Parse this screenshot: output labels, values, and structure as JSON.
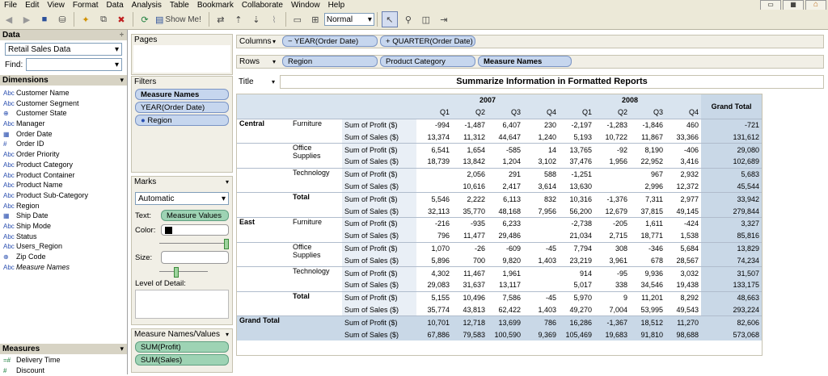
{
  "menu": [
    "File",
    "Edit",
    "View",
    "Format",
    "Data",
    "Analysis",
    "Table",
    "Bookmark",
    "Collaborate",
    "Window",
    "Help"
  ],
  "toolbar": {
    "show_me": "Show Me!",
    "fit": "Normal"
  },
  "data_pane": {
    "header": "Data",
    "source": "Retail Sales Data",
    "find_label": "Find:",
    "dimensions_header": "Dimensions",
    "dimensions": [
      {
        "icon": "Abc",
        "name": "Customer Name"
      },
      {
        "icon": "Abc",
        "name": "Customer Segment"
      },
      {
        "icon": "⊕",
        "name": "Customer State"
      },
      {
        "icon": "Abc",
        "name": "Manager"
      },
      {
        "icon": "▦",
        "name": "Order Date"
      },
      {
        "icon": "#",
        "name": "Order ID"
      },
      {
        "icon": "Abc",
        "name": "Order Priority"
      },
      {
        "icon": "Abc",
        "name": "Product Category"
      },
      {
        "icon": "Abc",
        "name": "Product Container"
      },
      {
        "icon": "Abc",
        "name": "Product Name"
      },
      {
        "icon": "Abc",
        "name": "Product Sub-Category"
      },
      {
        "icon": "Abc",
        "name": "Region"
      },
      {
        "icon": "▦",
        "name": "Ship Date"
      },
      {
        "icon": "Abc",
        "name": "Ship Mode"
      },
      {
        "icon": "Abc",
        "name": "Status"
      },
      {
        "icon": "Abc",
        "name": "Users_Region"
      },
      {
        "icon": "⊕",
        "name": "Zip Code"
      },
      {
        "icon": "Abc",
        "name": "Measure Names"
      }
    ],
    "measures_header": "Measures",
    "measures": [
      {
        "icon": "=#",
        "name": "Delivery Time"
      },
      {
        "icon": "#",
        "name": "Discount"
      }
    ]
  },
  "pages": {
    "label": "Pages"
  },
  "filters": {
    "label": "Filters",
    "items": [
      "Measure Names",
      "YEAR(Order Date)",
      "Region"
    ]
  },
  "marks": {
    "label": "Marks",
    "type": "Automatic",
    "text_label": "Text:",
    "text_pill": "Measure Values",
    "color_label": "Color:",
    "size_label": "Size:",
    "lod_label": "Level of Detail:"
  },
  "measure_values": {
    "label": "Measure Names/Values",
    "items": [
      "SUM(Profit)",
      "SUM(Sales)"
    ]
  },
  "columns": {
    "label": "Columns",
    "pills": [
      "YEAR(Order Date)",
      "QUARTER(Order Date)"
    ],
    "signs": [
      "−",
      "+"
    ]
  },
  "rows": {
    "label": "Rows",
    "pills": [
      "Region",
      "Product Category",
      "Measure Names"
    ]
  },
  "title": {
    "label": "Title",
    "text": "Summarize Information in Formatted Reports"
  },
  "crosstab": {
    "years": [
      "2007",
      "2008"
    ],
    "quarters": [
      "Q1",
      "Q2",
      "Q3",
      "Q4"
    ],
    "grand_total": "Grand Total",
    "measures": [
      "Sum of Profit ($)",
      "Sum of Sales ($)"
    ],
    "rows": [
      {
        "region": "Central",
        "category": "Furniture",
        "profit": [
          "-994",
          "-1,487",
          "6,407",
          "230",
          "-2,197",
          "-1,283",
          "-1,846",
          "460",
          "-721"
        ],
        "sales": [
          "13,374",
          "11,312",
          "44,647",
          "1,240",
          "5,193",
          "10,722",
          "11,867",
          "33,366",
          "131,612"
        ]
      },
      {
        "region": "",
        "category": "Office Supplies",
        "profit": [
          "6,541",
          "1,654",
          "-585",
          "14",
          "13,765",
          "-92",
          "8,190",
          "-406",
          "29,080"
        ],
        "sales": [
          "18,739",
          "13,842",
          "1,204",
          "3,102",
          "37,476",
          "1,956",
          "22,952",
          "3,416",
          "102,689"
        ]
      },
      {
        "region": "",
        "category": "Technology",
        "profit": [
          "",
          "2,056",
          "291",
          "588",
          "-1,251",
          "",
          "967",
          "2,932",
          "5,683"
        ],
        "sales": [
          "",
          "10,616",
          "2,417",
          "3,614",
          "13,630",
          "",
          "2,996",
          "12,372",
          "45,544"
        ]
      },
      {
        "region": "",
        "category": "Total",
        "profit": [
          "5,546",
          "2,222",
          "6,113",
          "832",
          "10,316",
          "-1,376",
          "7,311",
          "2,977",
          "33,942"
        ],
        "sales": [
          "32,113",
          "35,770",
          "48,168",
          "7,956",
          "56,200",
          "12,679",
          "37,815",
          "49,145",
          "279,844"
        ]
      },
      {
        "region": "East",
        "category": "Furniture",
        "profit": [
          "-216",
          "-935",
          "6,233",
          "",
          "-2,738",
          "-205",
          "1,611",
          "-424",
          "3,327"
        ],
        "sales": [
          "796",
          "11,477",
          "29,486",
          "",
          "21,034",
          "2,715",
          "18,771",
          "1,538",
          "85,816"
        ]
      },
      {
        "region": "",
        "category": "Office Supplies",
        "profit": [
          "1,070",
          "-26",
          "-609",
          "-45",
          "7,794",
          "308",
          "-346",
          "5,684",
          "13,829"
        ],
        "sales": [
          "5,896",
          "700",
          "9,820",
          "1,403",
          "23,219",
          "3,961",
          "678",
          "28,567",
          "74,234"
        ]
      },
      {
        "region": "",
        "category": "Technology",
        "profit": [
          "4,302",
          "11,467",
          "1,961",
          "",
          "914",
          "-95",
          "9,936",
          "3,032",
          "31,507"
        ],
        "sales": [
          "29,083",
          "31,637",
          "13,117",
          "",
          "5,017",
          "338",
          "34,546",
          "19,438",
          "133,175"
        ]
      },
      {
        "region": "",
        "category": "Total",
        "profit": [
          "5,155",
          "10,496",
          "7,586",
          "-45",
          "5,970",
          "9",
          "11,201",
          "8,292",
          "48,663"
        ],
        "sales": [
          "35,774",
          "43,813",
          "62,422",
          "1,403",
          "49,270",
          "7,004",
          "53,995",
          "49,543",
          "293,224"
        ]
      },
      {
        "region": "Grand Total",
        "category": "",
        "profit": [
          "10,701",
          "12,718",
          "13,699",
          "786",
          "16,286",
          "-1,367",
          "18,512",
          "11,270",
          "82,606"
        ],
        "sales": [
          "67,886",
          "79,583",
          "100,590",
          "9,369",
          "105,469",
          "19,683",
          "91,810",
          "98,688",
          "573,068"
        ]
      }
    ]
  }
}
